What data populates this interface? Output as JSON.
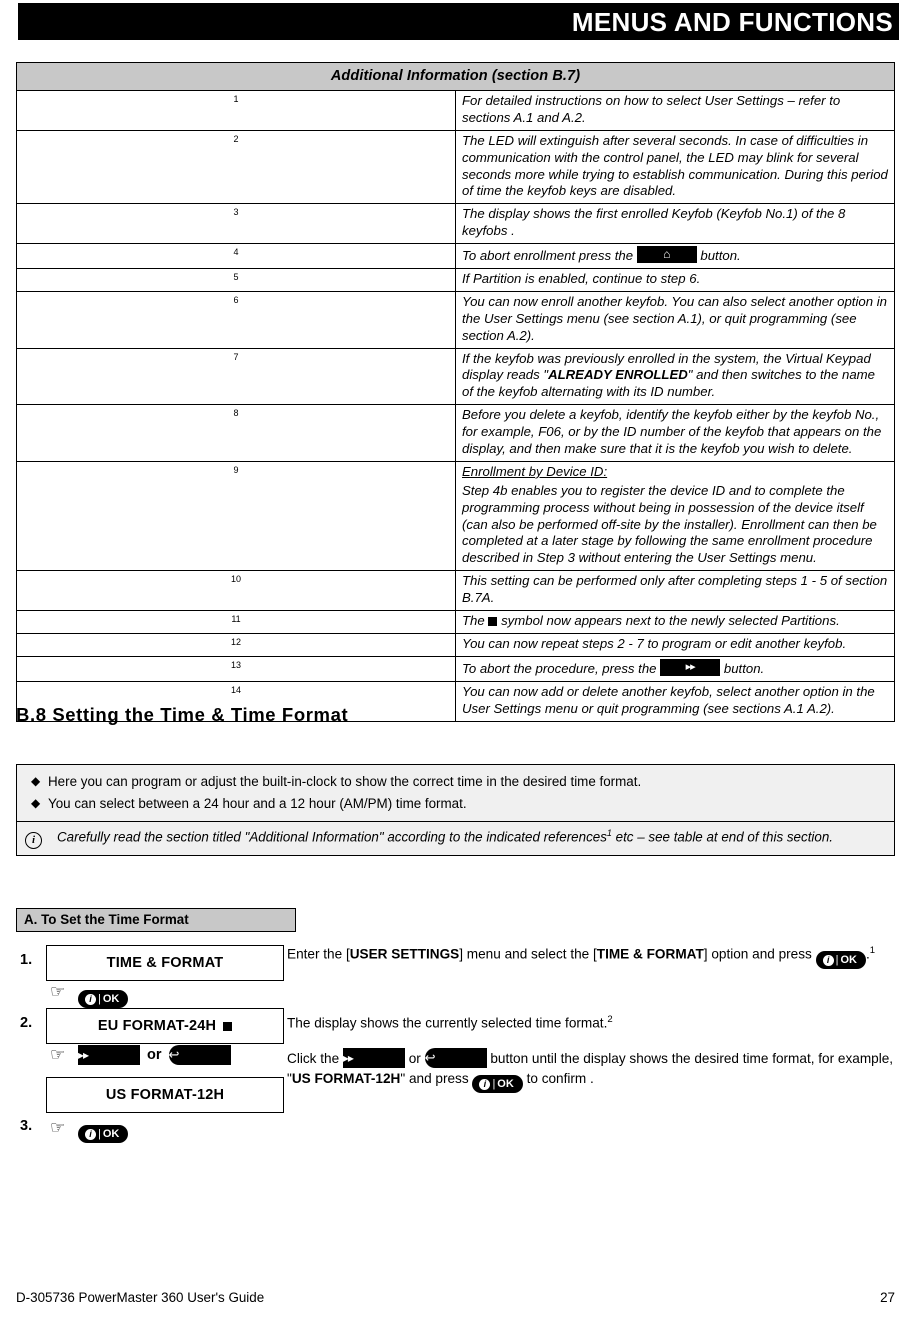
{
  "header": {
    "title": "MENUS AND FUNCTIONS"
  },
  "info_table": {
    "caption": "Additional Information (section B.7)",
    "rows": [
      {
        "num": "1",
        "text": "For detailed instructions on how to select User Settings – refer to sections A.1 and A.2."
      },
      {
        "num": "2",
        "text": "The LED will extinguish after several seconds. In case of difficulties in communication with the control panel, the LED may blink for several seconds more while trying to establish communication. During this period of time the keyfob keys are disabled."
      },
      {
        "num": "3",
        "text": "The display shows the first enrolled Keyfob (Keyfob No.1) of the 8 keyfobs ."
      },
      {
        "num": "4",
        "text_before": "To abort enrollment press the",
        "icon": "away-arm-key-icon",
        "text_after": "button."
      },
      {
        "num": "5",
        "text": "If Partition is enabled, continue to step 6."
      },
      {
        "num": "6",
        "text": "You can now enroll another keyfob. You can also select another option in the User Settings menu (see section A.1), or quit programming (see section A.2)."
      },
      {
        "num": "7",
        "text_before": "If the keyfob was previously enrolled in the system, the Virtual Keypad display reads \"",
        "emphasis": "ALREADY ENROLLED",
        "text_after": "\" and then switches to the name of the keyfob alternating with its ID number."
      },
      {
        "num": "8",
        "text": "Before you delete a keyfob, identify the keyfob either by the keyfob No., for example, F06, or by the ID number of the keyfob that appears on the display, and then make sure that it is the keyfob you wish to delete."
      },
      {
        "num": "9",
        "heading": "Enrollment by Device ID:",
        "text": "Step 4b enables you to register the device ID and to complete the programming process without being in possession of the device itself (can also be performed off-site by the installer). Enrollment can then be completed at a later stage by following the same enrollment procedure described in Step 3 without entering the User Settings menu."
      },
      {
        "num": "10",
        "text": "This setting can be performed only after completing steps 1 - 5 of section B.7A."
      },
      {
        "num": "11",
        "text_before": "The",
        "symbol": "filled-square-symbol",
        "text_after": "symbol now appears next to the newly selected Partitions."
      },
      {
        "num": "12",
        "text": "You can now repeat steps 2 - 7 to program or edit another keyfob."
      },
      {
        "num": "13",
        "text_before": "To abort the procedure, press the",
        "icon": "next-forward-key-icon",
        "text_after": "button."
      },
      {
        "num": "14",
        "text": "You can now add or delete another keyfob, select another option in the User Settings menu or quit programming (see sections A.1 A.2)."
      }
    ]
  },
  "section": {
    "heading": "B.8 Setting the Time & Time Format",
    "bullets": [
      "Here you can program or adjust the built-in-clock to show the correct time in the desired time format.",
      "You can select between a 24 hour and a 12 hour (AM/PM) time format."
    ],
    "note": {
      "text_before": "Carefully read the section titled \"Additional Information\" according to the indicated references",
      "superscript": "1",
      "text_after": " etc – see table at end of this section."
    }
  },
  "subsection": {
    "bar_label": "A. To Set the Time Format",
    "steps": [
      {
        "num": "1."
      },
      {
        "num": "2."
      },
      {
        "num": "3."
      }
    ],
    "displays": {
      "time_format": "TIME & FORMAT",
      "eu_format": "EU FORMAT-24H",
      "us_format": "US FORMAT-12H"
    },
    "or_label": "or",
    "instructions": {
      "step1_a": "Enter the [",
      "step1_b": "USER SETTINGS",
      "step1_c": "] menu and select the [",
      "step1_d": "TIME & FORMAT",
      "step1_e": "] option and press",
      "step1_f": ".",
      "step1_sup": "1",
      "step2_a": "The display shows the currently selected time format.",
      "step2_sup": "2",
      "step2_b": "Click the",
      "step2_c": "or",
      "step2_d": "button until the display shows the desired time format, for example, \"",
      "step2_e": "US FORMAT-12H",
      "step2_f": "\" and press",
      "step2_g": "to confirm ."
    }
  },
  "footer": {
    "left": "D-305736 PowerMaster 360 User's Guide",
    "right": "27"
  },
  "icons": {
    "ok_key": "ok-key-icon",
    "info_circle": "info-circle-icon",
    "hand_pointer": "hand-pointer-icon",
    "forward_key": "forward-key-icon",
    "back_key": "back-key-icon"
  }
}
